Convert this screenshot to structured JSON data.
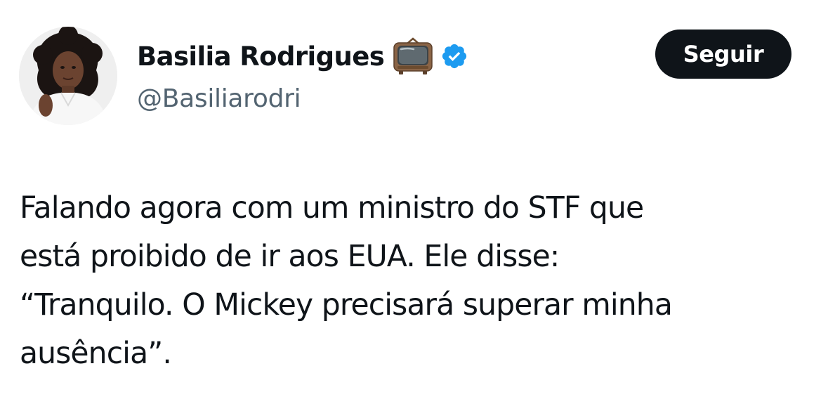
{
  "tweet": {
    "author": {
      "display_name": "Basilia Rodrigues",
      "emoji_icon": "television-icon",
      "verified_icon": "verified-badge-icon",
      "handle": "@Basiliarodri"
    },
    "follow_button_label": "Seguir",
    "text_lines": [
      "Falando agora com um ministro do STF que",
      "está proibido de ir aos EUA. Ele disse:",
      "“Tranquilo. O Mickey precisará superar minha",
      "ausência”."
    ]
  },
  "colors": {
    "text_primary": "#0f1419",
    "text_secondary": "#536471",
    "button_background": "#0f1419",
    "button_text": "#ffffff",
    "verified_blue": "#1d9bf0"
  }
}
